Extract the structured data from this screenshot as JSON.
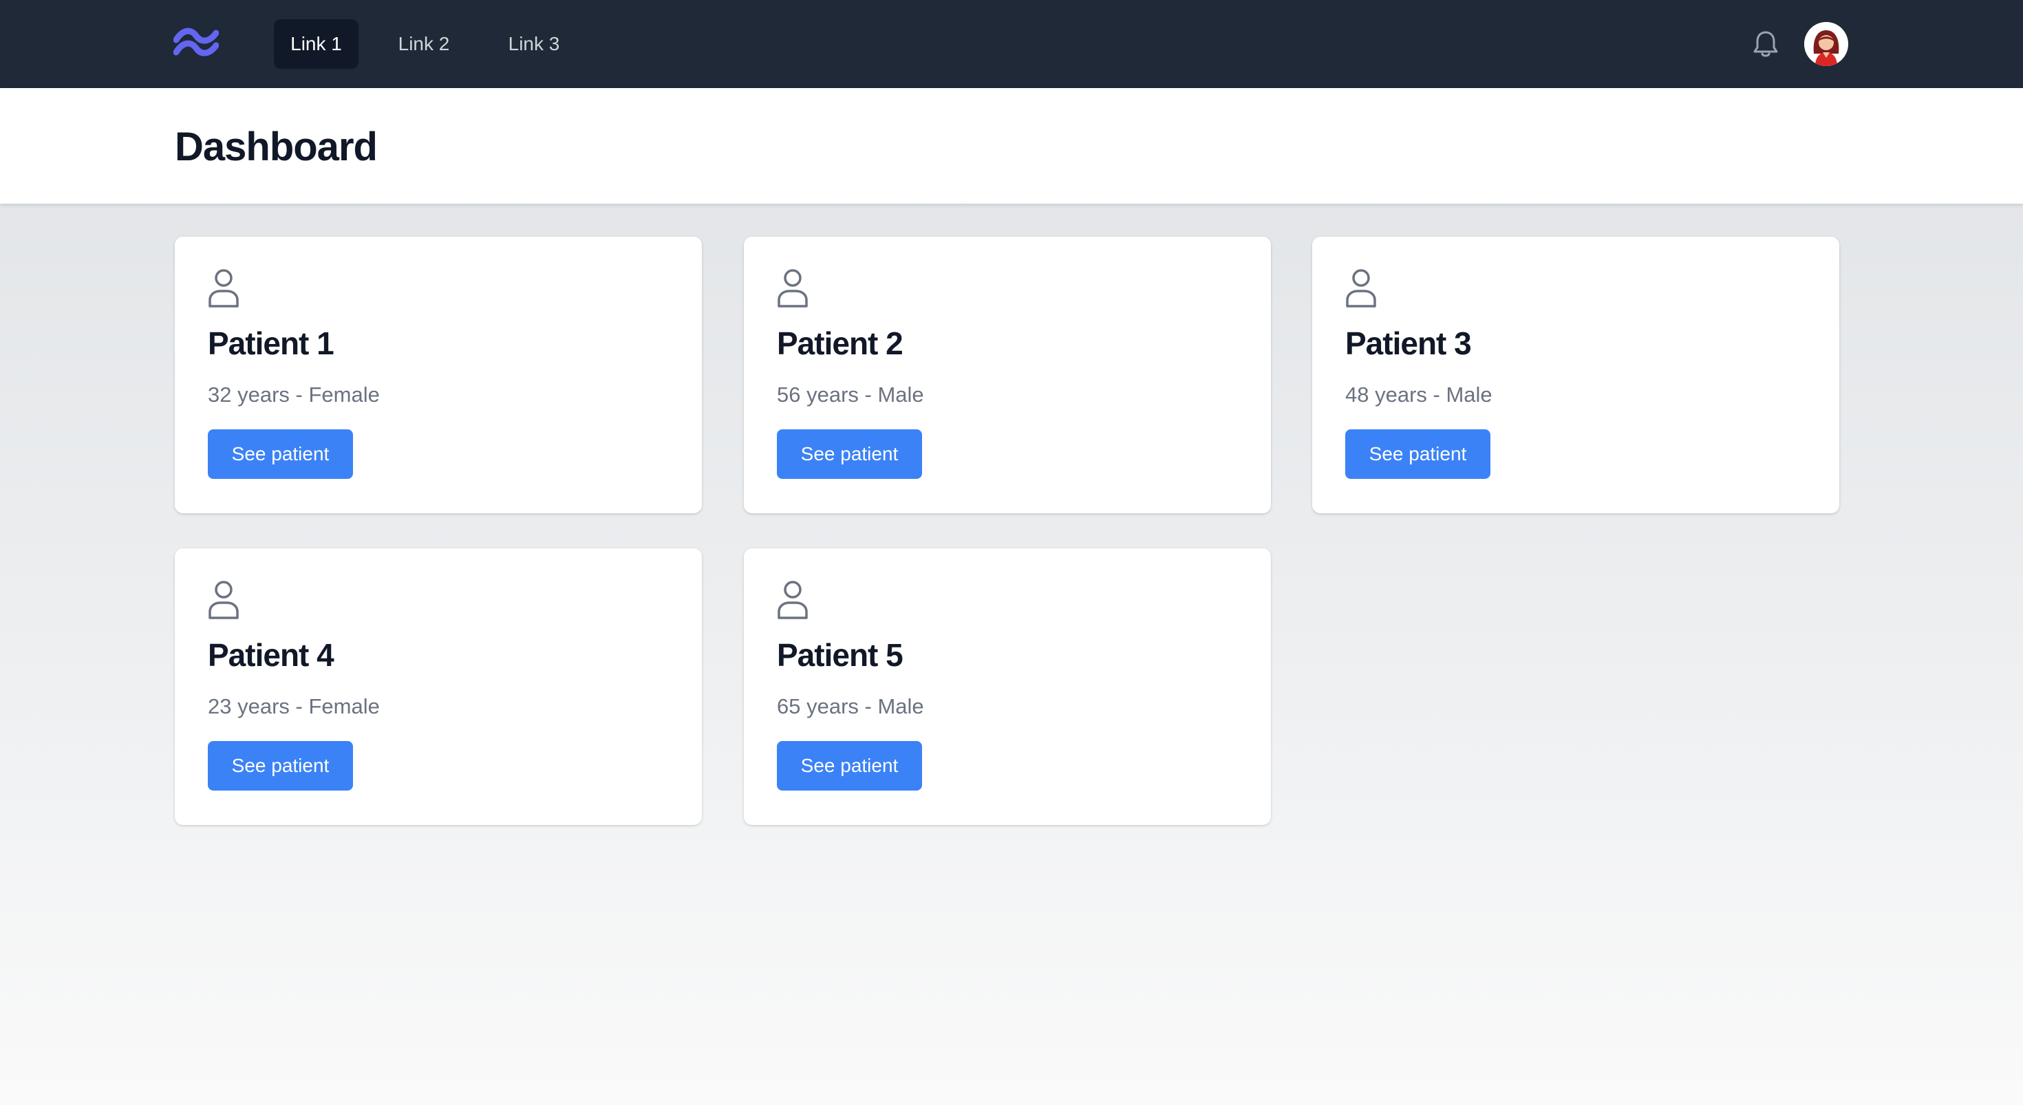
{
  "nav": {
    "logo_icon": "tailwind-wave-icon",
    "links": [
      "Link 1",
      "Link 2",
      "Link 3"
    ],
    "active_index": 0,
    "notification_icon": "bell-icon",
    "avatar": "user-avatar"
  },
  "page": {
    "title": "Dashboard"
  },
  "patients": [
    {
      "name": "Patient 1",
      "meta": "32 years - Female",
      "button": "See patient"
    },
    {
      "name": "Patient 2",
      "meta": "56 years - Male",
      "button": "See patient"
    },
    {
      "name": "Patient 3",
      "meta": "48 years - Male",
      "button": "See patient"
    },
    {
      "name": "Patient 4",
      "meta": "23 years - Female",
      "button": "See patient"
    },
    {
      "name": "Patient 5",
      "meta": "65 years - Male",
      "button": "See patient"
    }
  ],
  "colors": {
    "nav_bg": "#1f2937",
    "active_link_bg": "#111827",
    "button_bg": "#3b82f6",
    "logo": "#6366f1",
    "title_text": "#111827",
    "meta_text": "#6b7280"
  }
}
